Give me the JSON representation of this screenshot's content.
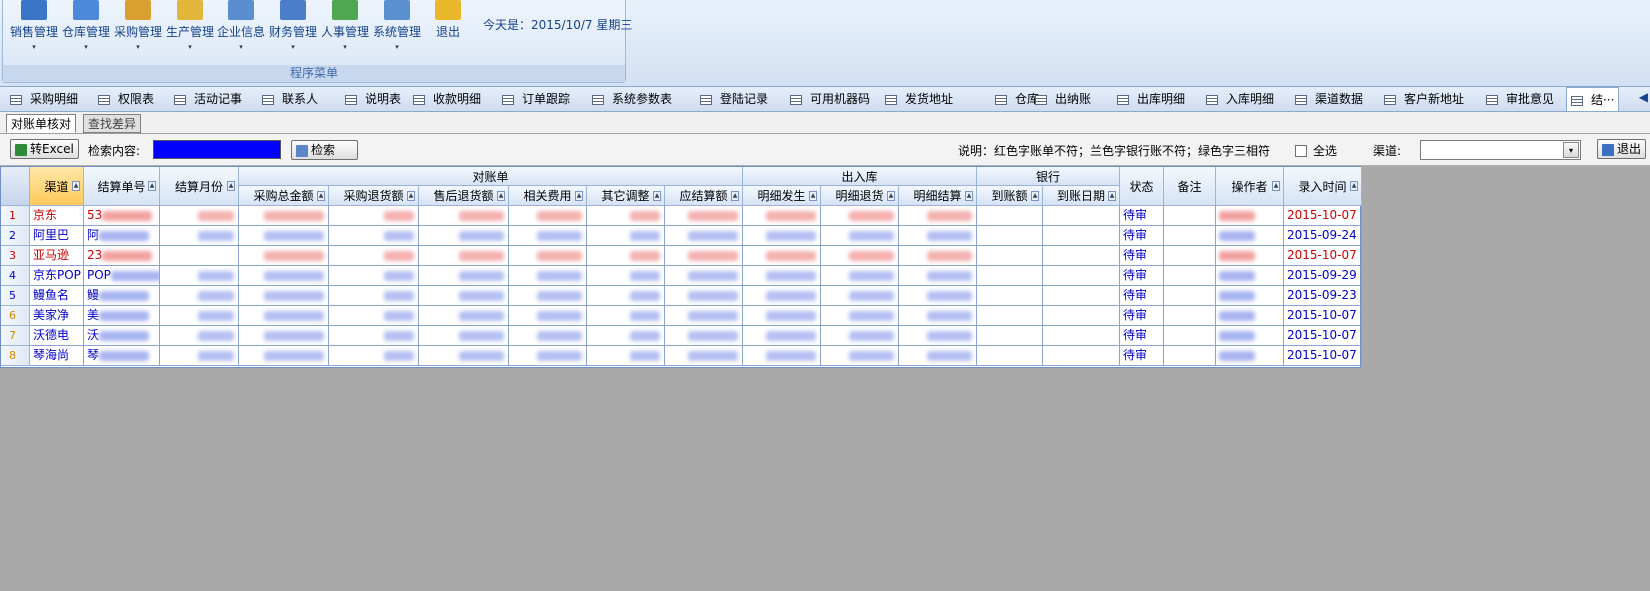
{
  "ribbon": {
    "buttons": [
      {
        "label": "销售管理",
        "icon": "sales-icon",
        "has_menu": true
      },
      {
        "label": "仓库管理",
        "icon": "warehouse-icon",
        "has_menu": true
      },
      {
        "label": "采购管理",
        "icon": "purchase-icon",
        "has_menu": true
      },
      {
        "label": "生产管理",
        "icon": "production-icon",
        "has_menu": true
      },
      {
        "label": "企业信息",
        "icon": "company-icon",
        "has_menu": true
      },
      {
        "label": "财务管理",
        "icon": "finance-icon",
        "has_menu": true
      },
      {
        "label": "人事管理",
        "icon": "hr-icon",
        "has_menu": true
      },
      {
        "label": "系统管理",
        "icon": "system-icon",
        "has_menu": true
      },
      {
        "label": "退出",
        "icon": "exit-icon",
        "has_menu": false
      }
    ],
    "today": "今天是：2015/10/7  星期三",
    "group_label": "程序菜单",
    "dropdown_arrow": "▾"
  },
  "tabs": [
    "采购明细",
    "权限表",
    "活动记事",
    "联系人",
    "说明表",
    "收款明细",
    "订单跟踪",
    "系统参数表",
    "登陆记录",
    "可用机器码",
    "发货地址",
    "仓库",
    "出纳账",
    "出库明细",
    "入库明细",
    "渠道数据",
    "客户新地址",
    "审批意见",
    "结···"
  ],
  "tab_nav": "◀",
  "subtabs": [
    "对账单核对",
    "查找差异"
  ],
  "toolbar": {
    "excel_label": "转Excel",
    "search_label": "检索内容:",
    "search_button": "检索",
    "note": "说明：红色字账单不符；兰色字银行账不符；绿色字三相符",
    "select_all": "全选",
    "channel_label": "渠道:",
    "exit_label": "退出"
  },
  "grid": {
    "group_headers": {
      "statement": "对账单",
      "inout": "出入库",
      "bank": "银行"
    },
    "columns": {
      "channel": "渠道",
      "settle_no": "结算单号",
      "settle_month": "结算月份",
      "purchase_total": "采购总金额",
      "purchase_return": "采购退货额",
      "after_sales_return": "售后退货额",
      "related_fees": "相关费用",
      "other_adjust": "其它调整",
      "payable": "应结算额",
      "detail_occur": "明细发生",
      "detail_return": "明细退货",
      "detail_settle": "明细结算",
      "arrived_amount": "到账额",
      "arrived_date": "到账日期",
      "status": "状态",
      "remark": "备注",
      "operator": "操作者",
      "entry_time": "录入时间"
    },
    "rows": [
      {
        "num": "1",
        "channel": "京东",
        "settle_no": "53",
        "status": "待审",
        "entry_time": "2015-10-07",
        "color": "#cc0000"
      },
      {
        "num": "2",
        "channel": "阿里巴",
        "settle_no": "阿",
        "status": "待审",
        "entry_time": "2015-09-24",
        "color": "#0000cc"
      },
      {
        "num": "3",
        "channel": "亚马逊",
        "settle_no": "23",
        "status": "待审",
        "entry_time": "2015-10-07",
        "color": "#cc0000"
      },
      {
        "num": "4",
        "channel": "京东POP",
        "settle_no": "POP",
        "status": "待审",
        "entry_time": "2015-09-29",
        "color": "#0000cc"
      },
      {
        "num": "5",
        "channel": "鳗鱼名",
        "settle_no": "鳗",
        "status": "待审",
        "entry_time": "2015-09-23",
        "color": "#0000cc"
      },
      {
        "num": "6",
        "channel": "美家净",
        "settle_no": "美",
        "status": "待审",
        "entry_time": "2015-10-07",
        "color": "#0000cc"
      },
      {
        "num": "7",
        "channel": "沃德电",
        "settle_no": "沃",
        "status": "待审",
        "entry_time": "2015-10-07",
        "color": "#0000cc"
      },
      {
        "num": "8",
        "channel": "琴海尚",
        "settle_no": "琴",
        "status": "待审",
        "entry_time": "2015-10-07",
        "color": "#0000cc"
      }
    ]
  },
  "colors": {
    "mismatch_statement": "#cc0000",
    "mismatch_bank": "#0000cc",
    "search_box": "#0000ff",
    "selected_header": "#ffc95b"
  }
}
